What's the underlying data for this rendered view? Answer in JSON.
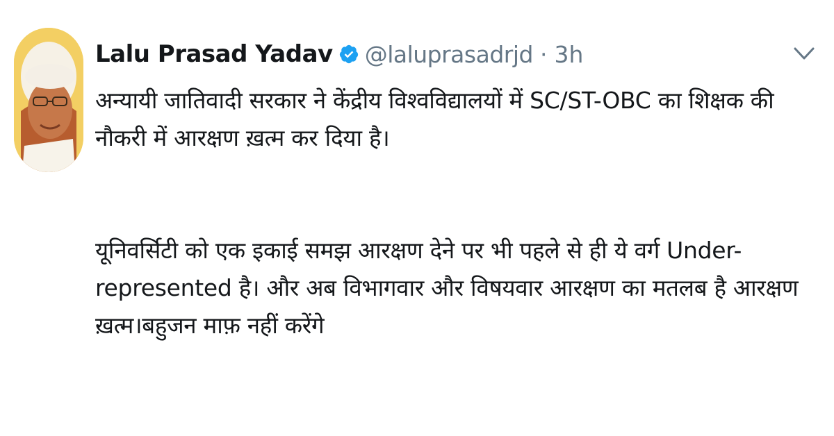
{
  "tweet": {
    "author_name": "Lalu Prasad Yadav",
    "handle": "@laluprasadrjd",
    "separator": "·",
    "time": "3h",
    "paragraphs": [
      "अन्यायी जातिवादी सरकार ने केंद्रीय विश्वविद्यालयों में SC/ST-OBC का शिक्षक की नौकरी में आरक्षण ख़त्म कर दिया है।",
      "यूनिवर्सिटी को एक इकाई समझ आरक्षण देने पर भी पहले से ही ये वर्ग Under-represented है। और अब विभागवार और विषयवार आरक्षण का मतलब है आरक्षण ख़त्म।बहुजन माफ़ नहीं करेंगे"
    ]
  },
  "icons": {
    "verified": "verified-badge-icon",
    "caret": "chevron-down-icon"
  },
  "colors": {
    "text": "#14171a",
    "secondary": "#657786",
    "verified": "#1da1f2"
  }
}
